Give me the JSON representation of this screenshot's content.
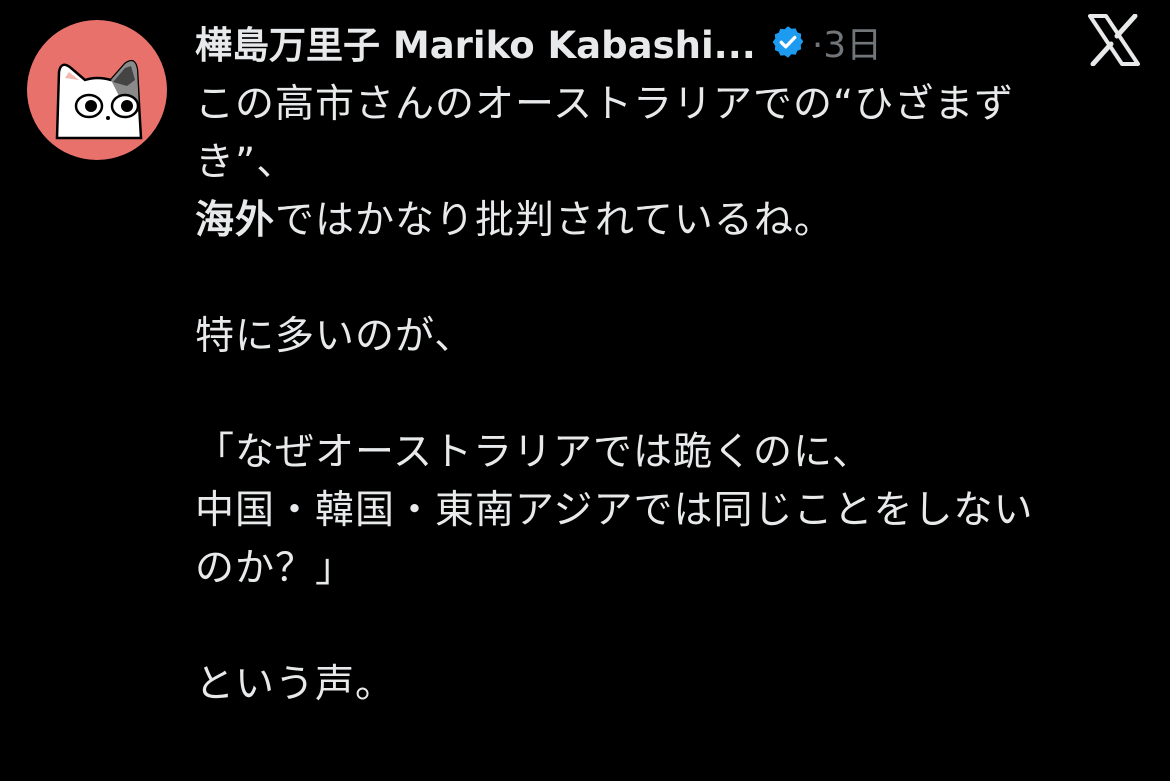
{
  "post": {
    "author": {
      "display_name": "樺島万里子 Mariko Kabashi...",
      "verified": true,
      "avatar": "cat-avatar-icon"
    },
    "meta": "·3日",
    "platform_icon": "x-logo-icon",
    "body": {
      "line1": "この高市さんのオーストラリアでの“ひざまず",
      "line2": "き”、",
      "line3_bold": "海外",
      "line3_rest": "ではかなり批判されているね。",
      "line4": "特に多いのが、",
      "line5": "「なぜオーストラリアでは跪くのに、",
      "line6": "中国・韓国・東南アジアでは同じことをしない",
      "line7": "のか？」",
      "line8": "という声。"
    }
  },
  "colors": {
    "background": "#000000",
    "text": "#e7e9ea",
    "muted": "#71767b",
    "verified_badge": "#1d9bf0",
    "avatar_bg": "#e8726b"
  }
}
